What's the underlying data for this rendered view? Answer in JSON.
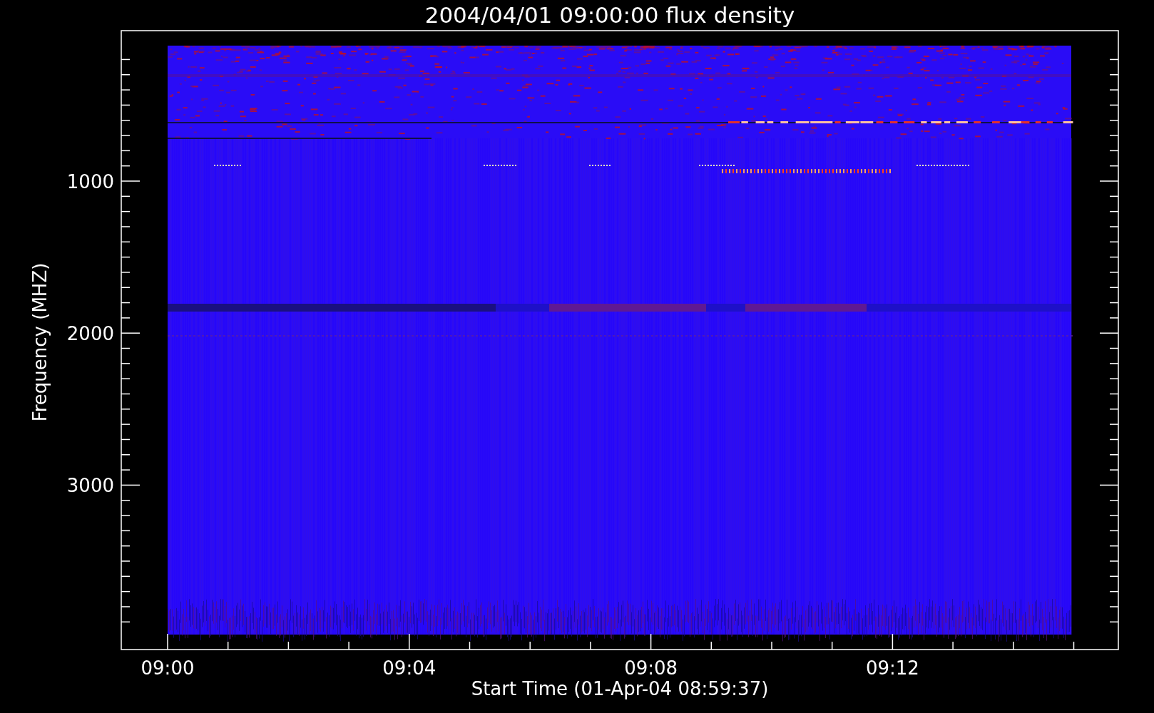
{
  "title": "2004/04/01 09:00:00 flux density",
  "y_axis": {
    "label": "Frequency (MHZ)",
    "ticks": [
      "1000",
      "2000",
      "3000"
    ]
  },
  "x_axis": {
    "label": "Start Time (01-Apr-04 08:59:37)",
    "ticks": [
      "09:00",
      "09:04",
      "09:08",
      "09:12"
    ]
  }
}
